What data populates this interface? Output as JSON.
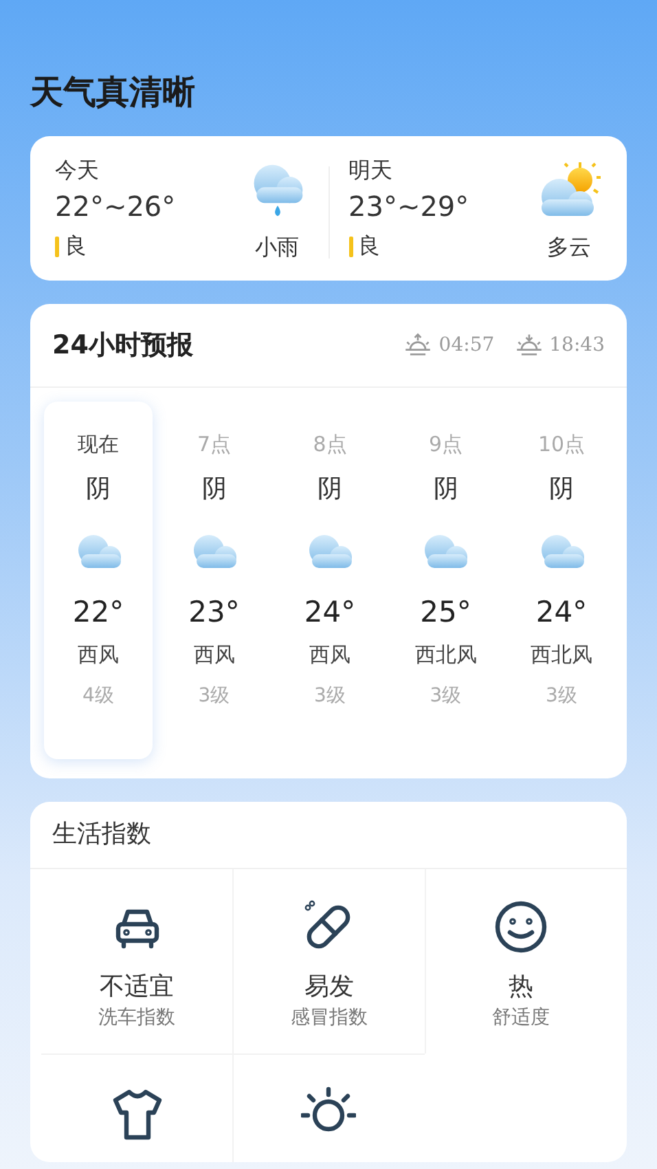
{
  "title": "天气真清晰",
  "days": [
    {
      "label": "今天",
      "range": "22°~26°",
      "quality": "良",
      "weather": "小雨",
      "kind": "rain"
    },
    {
      "label": "明天",
      "range": "23°~29°",
      "quality": "良",
      "weather": "多云",
      "kind": "partly-cloudy"
    }
  ],
  "hourly": {
    "title": "24小时预报",
    "sunrise": "04:57",
    "sunset": "18:43",
    "hours": [
      {
        "time": "现在",
        "condition": "阴",
        "temp": "22°",
        "wind": "西风",
        "level": "4级",
        "selected": true
      },
      {
        "time": "7点",
        "condition": "阴",
        "temp": "23°",
        "wind": "西风",
        "level": "3级",
        "selected": false
      },
      {
        "time": "8点",
        "condition": "阴",
        "temp": "24°",
        "wind": "西风",
        "level": "3级",
        "selected": false
      },
      {
        "time": "9点",
        "condition": "阴",
        "temp": "25°",
        "wind": "西北风",
        "level": "3级",
        "selected": false
      },
      {
        "time": "10点",
        "condition": "阴",
        "temp": "24°",
        "wind": "西北风",
        "level": "3级",
        "selected": false
      }
    ]
  },
  "life": {
    "title": "生活指数",
    "items": [
      {
        "kind": "car",
        "value": "不适宜",
        "name": "洗车指数"
      },
      {
        "kind": "pill",
        "value": "易发",
        "name": "感冒指数"
      },
      {
        "kind": "smile",
        "value": "热",
        "name": "舒适度"
      },
      {
        "kind": "shirt"
      },
      {
        "kind": "sun"
      }
    ]
  }
}
